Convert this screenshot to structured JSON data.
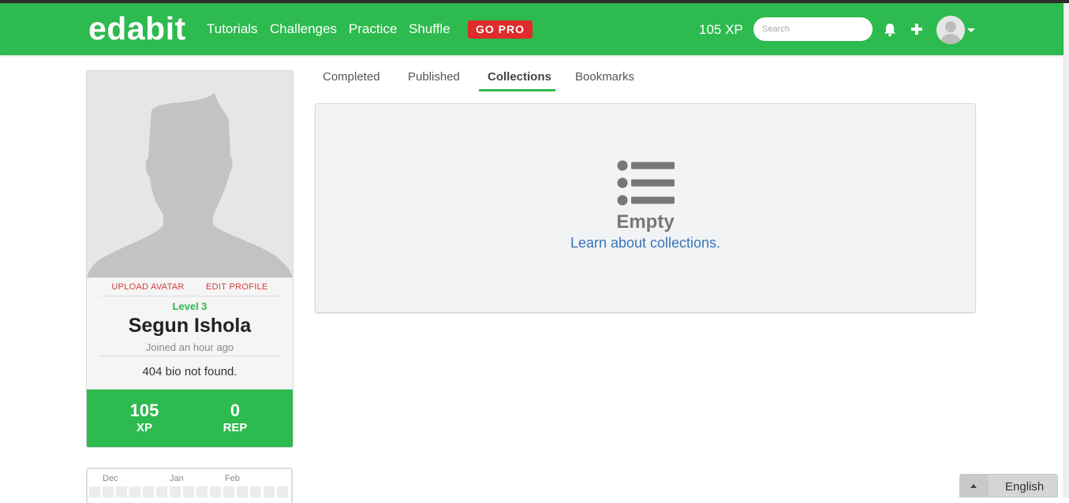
{
  "navbar": {
    "logo": "edabit",
    "links": [
      "Tutorials",
      "Challenges",
      "Practice",
      "Shuffle"
    ],
    "go_pro": "GO PRO",
    "xp": "105 XP",
    "search_placeholder": "Search",
    "brand_color": "#2dba4e",
    "pro_color": "#e02b2b"
  },
  "profile": {
    "upload_avatar": "UPLOAD AVATAR",
    "edit_profile": "EDIT PROFILE",
    "level": "Level 3",
    "name": "Segun Ishola",
    "joined": "Joined an hour ago",
    "bio": "404 bio not found.",
    "stats": [
      {
        "value": "105",
        "label": "XP"
      },
      {
        "value": "0",
        "label": "REP"
      }
    ]
  },
  "calendar": {
    "months": [
      "Dec",
      "Jan",
      "Feb"
    ]
  },
  "tabs": {
    "items": [
      "Completed",
      "Published",
      "Collections",
      "Bookmarks"
    ],
    "active": "Collections"
  },
  "panel": {
    "icon": "list-icon",
    "title": "Empty",
    "link": "Learn about collections."
  },
  "language": {
    "label": "English"
  }
}
